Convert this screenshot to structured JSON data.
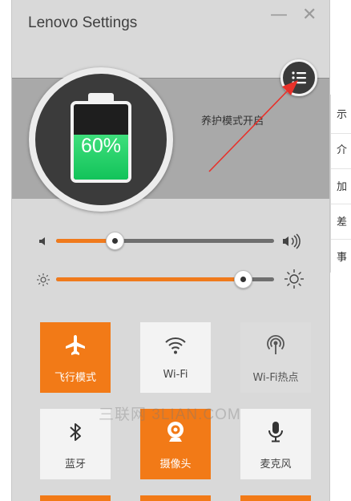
{
  "app": {
    "title": "Lenovo Settings",
    "minimize": "—",
    "close": "✕"
  },
  "battery": {
    "percent_label": "60%",
    "level": 0.6,
    "status": "养护模式开启",
    "fill_color": "#21cf68"
  },
  "menu": {
    "icon": "list-menu-icon"
  },
  "sliders": {
    "volume": {
      "level": 0.27,
      "low_icon": "volume-low-icon",
      "high_icon": "volume-high-icon"
    },
    "brightness": {
      "level": 0.86,
      "low_icon": "brightness-low-icon",
      "high_icon": "brightness-high-icon"
    }
  },
  "tiles": [
    {
      "label": "飞行模式",
      "state": "on",
      "icon": "airplane-icon"
    },
    {
      "label": "Wi-Fi",
      "state": "off",
      "icon": "wifi-icon"
    },
    {
      "label": "Wi-Fi热点",
      "state": "dim",
      "icon": "hotspot-icon"
    },
    {
      "label": "蓝牙",
      "state": "off",
      "icon": "bluetooth-icon"
    },
    {
      "label": "摄像头",
      "state": "on",
      "icon": "camera-icon"
    },
    {
      "label": "麦克风",
      "state": "off",
      "icon": "microphone-icon"
    }
  ],
  "watermark": "三联网 3LIAN.COM",
  "background_window": {
    "chars": [
      "示",
      "介",
      "加",
      "差",
      "事"
    ]
  },
  "colors": {
    "accent": "#f27a17",
    "panel": "#d9d9d9",
    "band": "#a9a9a9",
    "arrow": "#e8312a"
  }
}
